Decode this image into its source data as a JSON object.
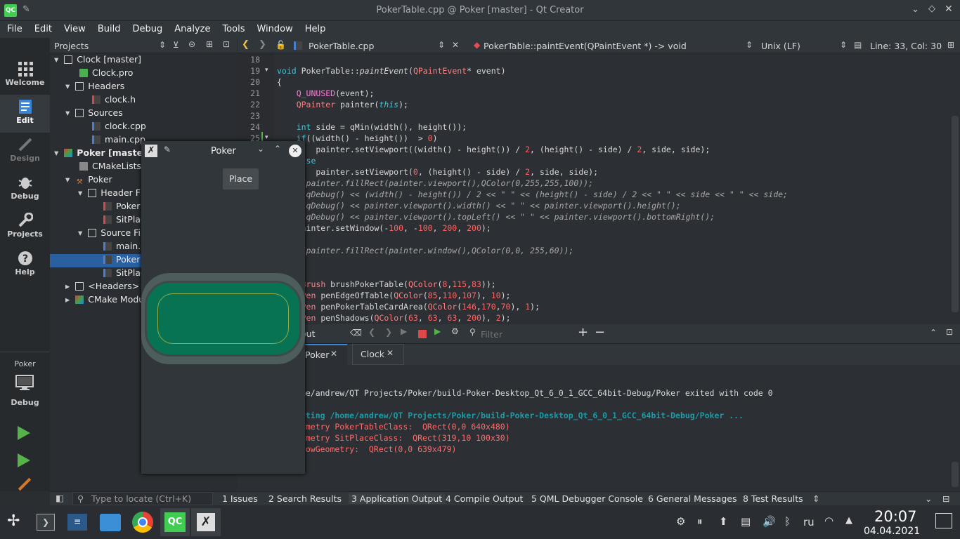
{
  "window": {
    "title": "PokerTable.cpp @ Poker [master] - Qt Creator"
  },
  "menu": [
    "File",
    "Edit",
    "View",
    "Build",
    "Debug",
    "Analyze",
    "Tools",
    "Window",
    "Help"
  ],
  "modes": [
    {
      "label": "Welcome",
      "icon": "grid-icon"
    },
    {
      "label": "Edit",
      "icon": "edit-icon"
    },
    {
      "label": "Design",
      "icon": "pencil-icon"
    },
    {
      "label": "Debug",
      "icon": "bug-icon"
    },
    {
      "label": "Projects",
      "icon": "wrench-icon"
    },
    {
      "label": "Help",
      "icon": "help-icon"
    }
  ],
  "kit": {
    "project": "Poker",
    "mode": "Debug"
  },
  "projects": {
    "header": "Projects",
    "items": [
      {
        "text": "Clock [master]",
        "bold": false
      },
      {
        "text": "Clock.pro"
      },
      {
        "text": "Headers"
      },
      {
        "text": "clock.h"
      },
      {
        "text": "Sources"
      },
      {
        "text": "clock.cpp"
      },
      {
        "text": "main.cpp"
      },
      {
        "text": "Poker [master]"
      },
      {
        "text": "CMakeLists.t"
      },
      {
        "text": "Poker"
      },
      {
        "text": "Header F"
      },
      {
        "text": "Poker"
      },
      {
        "text": "SitPlac"
      },
      {
        "text": "Source Fi"
      },
      {
        "text": "main.c"
      },
      {
        "text": "Poker"
      },
      {
        "text": "SitPlac"
      },
      {
        "text": "<Headers>"
      },
      {
        "text": "CMake Modu"
      }
    ]
  },
  "editor": {
    "file": "PokerTable.cpp",
    "function": "PokerTable::paintEvent(QPaintEvent *) -> void",
    "line_ending": "Unix (LF)",
    "position": "Line: 33, Col: 30",
    "line_numbers": [
      "18",
      "19",
      "20",
      "21",
      "22",
      "23",
      "24",
      "25"
    ]
  },
  "code": [
    "",
    "void PokerTable::paintEvent(QPaintEvent* event)",
    "{",
    "    Q_UNUSED(event);",
    "    QPainter painter(this);",
    "",
    "    int side = qMin(width(), height());",
    "    if((width() - height())  > 0)",
    "        painter.setViewport((width() - height()) / 2, (height() - side) / 2, side, side);",
    "    else",
    "        painter.setViewport(0, (height() - side) / 2, side, side);",
    "    //painter.fillRect(painter.viewport(),QColor(0,255,255,100));",
    "    //qDebug() << (width() - height()) / 2 << \" \" << (height() - side) / 2 << \" \" << side << \" \" << side;",
    "    //qDebug() << painter.viewport().width() << \" \" << painter.viewport().height();",
    "    //qDebug() << painter.viewport().topLeft() << \" \" << painter.viewport().bottomRight();",
    "    painter.setWindow(-100, -100, 200, 200);",
    "",
    "    //painter.fillRect(painter.window(),QColor(0,0, 255,60));",
    "",
    "",
    "    QBrush brushPokerTable(QColor(8,115,83));",
    "    QPen penEdgeOfTable(QColor(85,110,107), 10);",
    "    QPen penPokerTableCardArea(QColor(146,170,70), 1);",
    "    QPen penShadows(QColor(63, 63, 63, 200), 2);"
  ],
  "output": {
    "label": "out",
    "filter_placeholder": "Filter",
    "tabs": [
      "Poker",
      "Clock"
    ],
    "lines": [
      {
        "text": "ome/andrew/QT Projects/Poker/build-Poker-Desktop_Qt_6_0_1_GCC_64bit-Debug/Poker exited with code 0",
        "color": "#d0d0d0"
      },
      {
        "text": "",
        "color": "#d0d0d0"
      },
      {
        "text": "arting /home/andrew/QT Projects/Poker/build-Poker-Desktop_Qt_6_0_1_GCC_64bit-Debug/Poker ...",
        "color": "#1e9ba6"
      },
      {
        "text": "eometry PokerTableClass:  QRect(0,0 640x480)",
        "color": "#ff6a6a"
      },
      {
        "text": "eometry SitPlaceClass:  QRect(319,10 100x30)",
        "color": "#ff6a6a"
      },
      {
        "text": "ndowGeometry:  QRect(0,0 639x479)",
        "color": "#ff6a6a"
      }
    ]
  },
  "status": {
    "locate_placeholder": "Type to locate (Ctrl+K)",
    "panes": [
      "1  Issues",
      "2  Search Results",
      "3  Application Output",
      "4  Compile Output",
      "5  QML Debugger Console",
      "6  General Messages",
      "8  Test Results"
    ]
  },
  "poker_window": {
    "title": "Poker",
    "place_button": "Place"
  },
  "taskbar": {
    "lang": "ru",
    "time": "20:07",
    "date": "04.04.2021"
  },
  "colors": {
    "table_felt": "#087353",
    "table_edge": "#556e6b",
    "card_area": "#92aa46",
    "selection": "#2a5fa0"
  }
}
